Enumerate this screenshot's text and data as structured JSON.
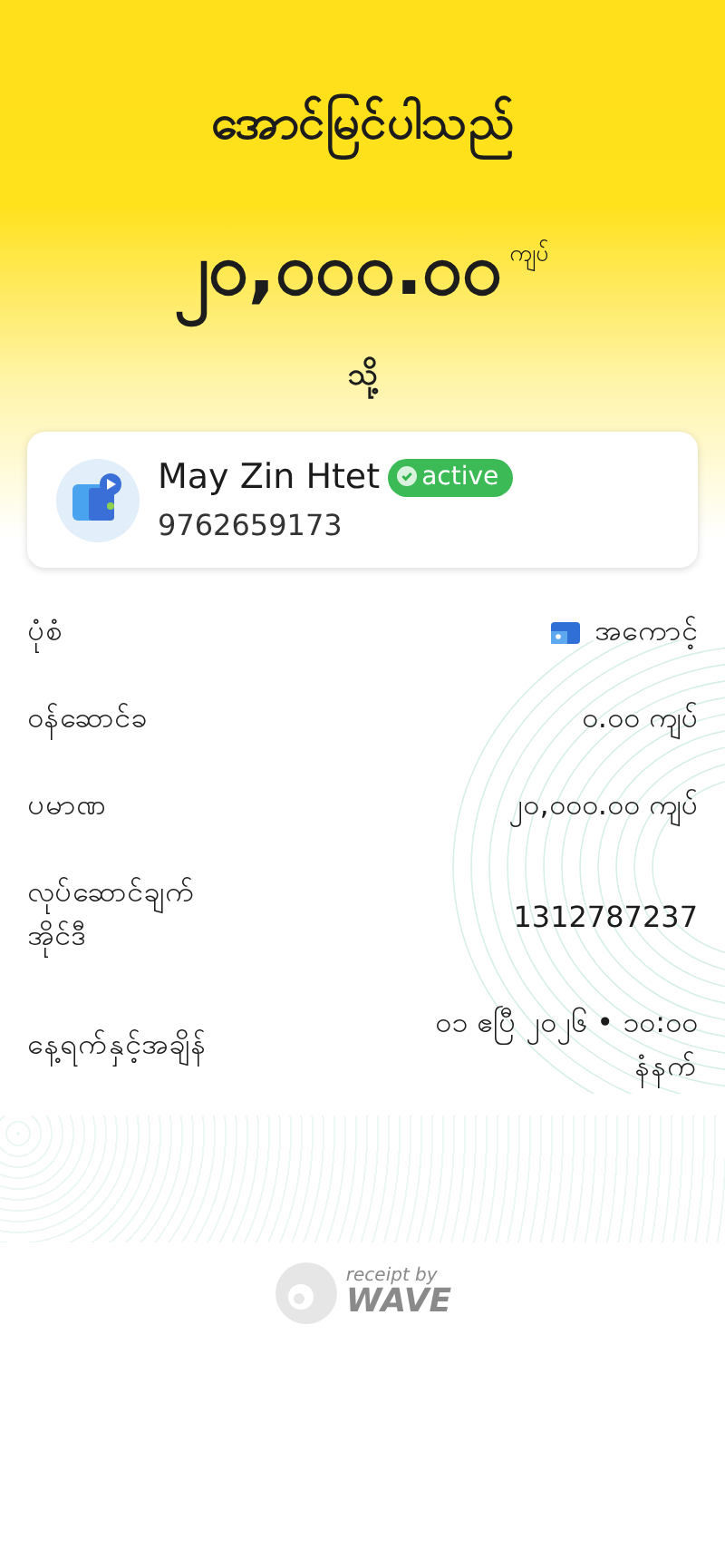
{
  "header": {
    "title": "အောင်မြင်ပါသည်",
    "amount": "၂၀,၀၀၀.၀၀",
    "currency": "ကျပ်",
    "to_label": "သို့"
  },
  "recipient": {
    "name": "May Zin Htet",
    "status": "active",
    "verified": true,
    "phone": "9762659173"
  },
  "details": [
    {
      "kind": "account",
      "label": "ပုံစံ",
      "value": "အကောင့်"
    },
    {
      "kind": "text",
      "label": "ဝန်ဆောင်ခ",
      "value": "၀.၀၀ ကျပ်"
    },
    {
      "kind": "text",
      "label": "ပမာဏ",
      "value": "၂၀,၀၀၀.၀၀ ကျပ်"
    },
    {
      "kind": "text",
      "label": "လုပ်ဆောင်ချက် အိုင်ဒီ",
      "value": "1312787237"
    },
    {
      "kind": "text",
      "label": "နေ့ရက်နှင့်အချိန်",
      "value": "၀၁ ဧပြီ ၂၀၂၆ • ၁၀:၀၀ နံနက်"
    }
  ],
  "footer": {
    "caption": "receipt by",
    "brand": "WAVE"
  }
}
